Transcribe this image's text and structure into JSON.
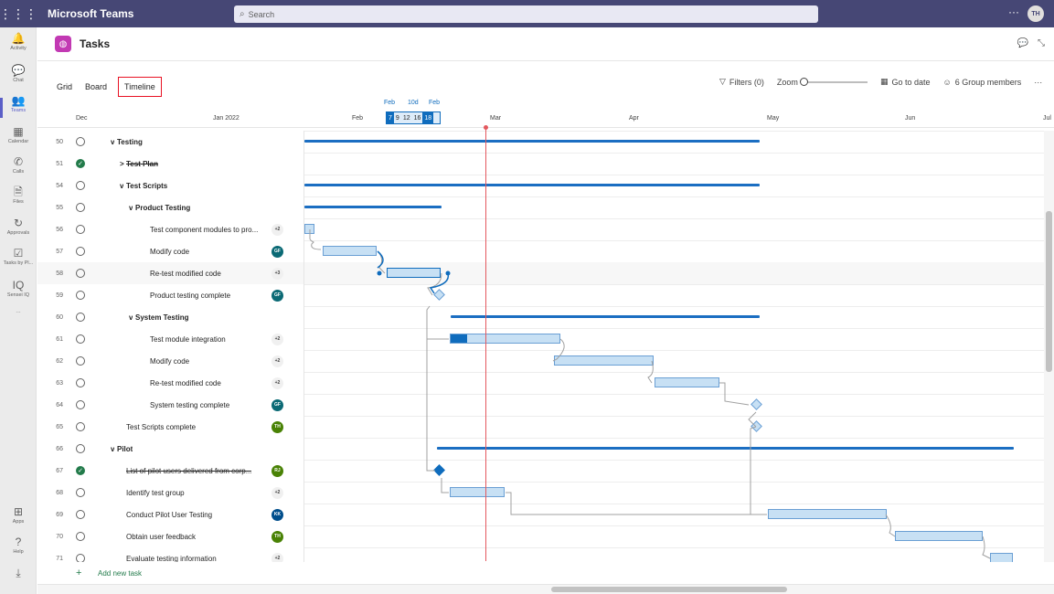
{
  "app": {
    "title": "Microsoft Teams",
    "search_placeholder": "Search",
    "avatar": "TH",
    "more": "···"
  },
  "rail": [
    {
      "label": "Activity",
      "icon": "bell-icon"
    },
    {
      "label": "Chat",
      "icon": "chat-icon"
    },
    {
      "label": "Teams",
      "icon": "teams-icon",
      "active": true
    },
    {
      "label": "Calendar",
      "icon": "calendar-icon"
    },
    {
      "label": "Calls",
      "icon": "phone-icon"
    },
    {
      "label": "Files",
      "icon": "file-icon"
    },
    {
      "label": "Approvals",
      "icon": "approvals-icon"
    },
    {
      "label": "Tasks by Pl...",
      "icon": "tasks-icon"
    },
    {
      "label": "Sensei IQ",
      "icon": "iq-icon"
    },
    {
      "label": "···",
      "icon": "more-icon"
    },
    {
      "label": "Apps",
      "icon": "apps-icon"
    },
    {
      "label": "Help",
      "icon": "help-icon"
    },
    {
      "label": "",
      "icon": "download-icon"
    }
  ],
  "header": {
    "title": "Tasks"
  },
  "views": [
    "Grid",
    "Board",
    "Timeline"
  ],
  "toolbar": {
    "filters": "Filters (0)",
    "zoom": "Zoom",
    "goto": "Go to date",
    "members": "6 Group members",
    "more": "···"
  },
  "timeline": {
    "months": [
      "Dec",
      "Jan 2022",
      "Feb",
      "Mar",
      "Apr",
      "May",
      "Jun",
      "Jul"
    ],
    "today_labels": [
      "Feb",
      "10d",
      "Feb"
    ],
    "dates": [
      "7",
      "9",
      "12",
      "16",
      "18"
    ]
  },
  "rows": [
    {
      "num": "50",
      "name": "Testing",
      "bold": true,
      "indent": 0,
      "chevron": "v"
    },
    {
      "num": "51",
      "name": "Test Plan",
      "bold": true,
      "strike": true,
      "done": true,
      "indent": 1,
      "chevron": ">"
    },
    {
      "num": "54",
      "name": "Test Scripts",
      "bold": true,
      "indent": 1,
      "chevron": "v"
    },
    {
      "num": "55",
      "name": "Product Testing",
      "bold": true,
      "indent": 2,
      "chevron": "v"
    },
    {
      "num": "56",
      "name": "Test component modules to pro...",
      "indent": 3,
      "assignee": "+2",
      "plus": true
    },
    {
      "num": "57",
      "name": "Modify code",
      "indent": 3,
      "assignee": "GF",
      "color": "#0b6a75"
    },
    {
      "num": "58",
      "name": "Re-test modified code",
      "indent": 3,
      "assignee": "+3",
      "plus": true,
      "highlight": true
    },
    {
      "num": "59",
      "name": "Product testing complete",
      "indent": 3,
      "assignee": "GF",
      "color": "#0b6a75"
    },
    {
      "num": "60",
      "name": "System Testing",
      "bold": true,
      "indent": 2,
      "chevron": "v"
    },
    {
      "num": "61",
      "name": "Test module integration",
      "indent": 3,
      "assignee": "+2",
      "plus": true
    },
    {
      "num": "62",
      "name": "Modify code",
      "indent": 3,
      "assignee": "+2",
      "plus": true
    },
    {
      "num": "63",
      "name": "Re-test modified code",
      "indent": 3,
      "assignee": "+2",
      "plus": true
    },
    {
      "num": "64",
      "name": "System testing complete",
      "indent": 3,
      "assignee": "GF",
      "color": "#0b6a75"
    },
    {
      "num": "65",
      "name": "Test Scripts complete",
      "indent": 1,
      "assignee": "TH",
      "color": "#498205"
    },
    {
      "num": "66",
      "name": "Pilot",
      "bold": true,
      "indent": 0,
      "chevron": "v"
    },
    {
      "num": "67",
      "name": "List of pilot users delivered from corp...",
      "strike": true,
      "done": true,
      "indent": 1,
      "assignee": "RJ",
      "color": "#498205"
    },
    {
      "num": "68",
      "name": "Identify test group",
      "indent": 1,
      "assignee": "+2",
      "plus": true
    },
    {
      "num": "69",
      "name": "Conduct Pilot User Testing",
      "indent": 1,
      "assignee": "KK",
      "color": "#004e8c"
    },
    {
      "num": "70",
      "name": "Obtain user feedback",
      "indent": 1,
      "assignee": "TH",
      "color": "#498205"
    },
    {
      "num": "71",
      "name": "Evaluate testing information",
      "indent": 1,
      "assignee": "+2",
      "plus": true
    }
  ],
  "add_task": "Add new task"
}
